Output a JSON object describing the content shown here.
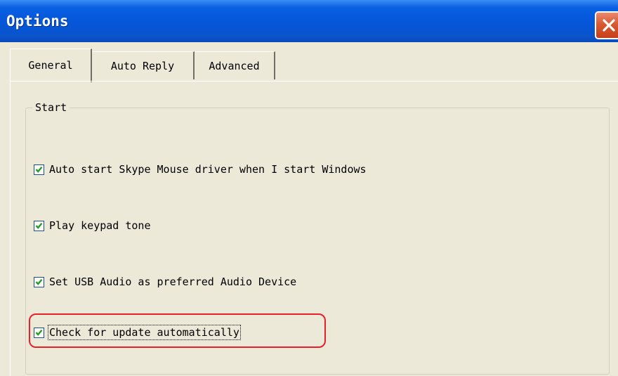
{
  "window": {
    "title": "Options"
  },
  "tabs": [
    {
      "label": "General",
      "active": true
    },
    {
      "label": "Auto Reply",
      "active": false
    },
    {
      "label": "Advanced",
      "active": false
    }
  ],
  "group": {
    "label": "Start"
  },
  "options": [
    {
      "label": "Auto start Skype Mouse driver when I start Windows",
      "checked": true
    },
    {
      "label": "Play keypad tone",
      "checked": true
    },
    {
      "label": "Set USB Audio as preferred Audio Device",
      "checked": true
    },
    {
      "label": "Check for update automatically",
      "checked": true,
      "focused": true,
      "highlighted": true
    }
  ],
  "icons": {
    "close": "close-icon",
    "checkmark": "checkmark-icon"
  },
  "colors": {
    "titlebar": "#0556d8",
    "close_button": "#d85b34",
    "dialog_background": "#ece9d8",
    "highlight_ring": "#e8202a"
  }
}
